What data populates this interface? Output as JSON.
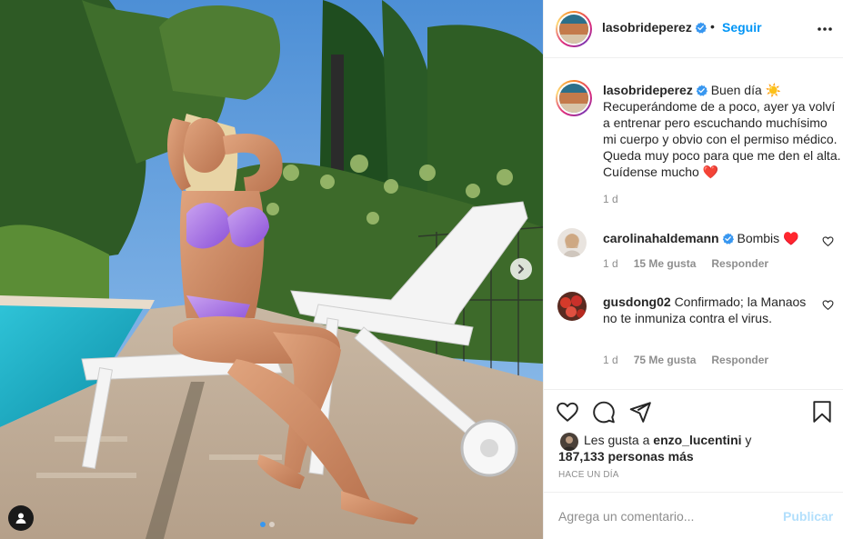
{
  "post": {
    "photo": {
      "description_icons": {
        "next": "chevron-right-icon",
        "tags": "user-tag-icon"
      },
      "slide_count": 2,
      "active_slide": 1
    },
    "header": {
      "username": "lasobrideperez",
      "separator": "•",
      "follow_label": "Seguir",
      "verified": true
    },
    "caption": {
      "username": "lasobrideperez",
      "text": "Buen día ☀️ Recuperándome de a poco, ayer ya volví a entrenar pero escuchando muchísimo mi cuerpo y obvio con el permiso médico. Queda muy poco para que me den el alta. Cuídense mucho ❤️",
      "time": "1 d"
    },
    "comments": [
      {
        "username": "carolinahaldemann",
        "verified": true,
        "text": "Bombis ♥️",
        "time": "1 d",
        "likes": "15 Me gusta",
        "reply_label": "Responder"
      },
      {
        "username": "gusdong02",
        "verified": false,
        "text": "Confirmado; la Manaos no te inmuniza contra el virus.",
        "time": "1 d",
        "likes": "75 Me gusta",
        "reply_label": "Responder"
      }
    ],
    "likes": {
      "prefix": "Les gusta a ",
      "user": "enzo_lucentini",
      "joiner": " y",
      "others": "187,133 personas más"
    },
    "posted_ago": "HACE UN DÍA",
    "add_comment": {
      "placeholder": "Agrega un comentario...",
      "value": "",
      "publish_label": "Publicar"
    },
    "colors": {
      "link_blue": "#0095f6",
      "publish_disabled": "#b2dffc",
      "muted": "#8e8e8e",
      "text": "#262626",
      "verified": "#3897f0"
    }
  }
}
